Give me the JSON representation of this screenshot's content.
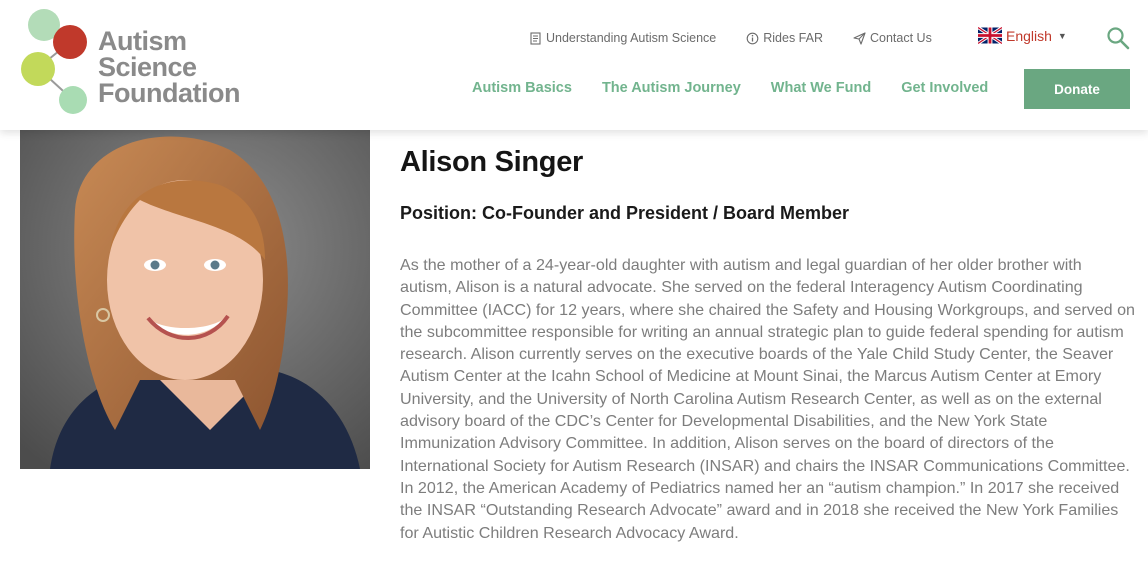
{
  "logo": {
    "line1": "Autism",
    "line2": "Science",
    "line3": "Foundation"
  },
  "util_nav": [
    {
      "label": "Understanding Autism Science",
      "icon": "document-icon"
    },
    {
      "label": "Rides FAR",
      "icon": "info-circle-icon"
    },
    {
      "label": "Contact Us",
      "icon": "paper-plane-icon"
    }
  ],
  "language": {
    "label": "English",
    "flag": "uk-flag-icon"
  },
  "main_nav": [
    {
      "label": "Autism Basics"
    },
    {
      "label": "The Autism Journey"
    },
    {
      "label": "What We Fund"
    },
    {
      "label": "Get Involved"
    }
  ],
  "donate_label": "Donate",
  "profile": {
    "name": "Alison Singer",
    "position": "Position: Co-Founder and President / Board Member",
    "bio": "As the mother of a 24-year-old daughter with autism and legal guardian of her older brother with autism, Alison is a natural advocate. She served on the federal Interagency Autism Coordinating Committee (IACC) for 12 years, where she chaired the Safety and Housing Workgroups, and served on the subcommittee responsible for writing an annual strategic plan to guide federal spending for autism research. Alison currently serves on the executive boards of the Yale Child Study Center, the Seaver Autism Center at the Icahn School of Medicine at Mount Sinai, the Marcus Autism Center at Emory University, and the University of North Carolina Autism Research Center, as well as on the external advisory board of the CDC’s Center for Developmental Disabilities, and the New York State Immunization Advisory Committee. In addition, Alison serves on the board of directors of the International Society for Autism Research (INSAR) and chairs the INSAR Communications Committee. In 2012, the American Academy of Pediatrics named her an “autism champion.” In 2017 she received the INSAR “Outstanding Research Advocate” award and in 2018 she received the New York Families for Autistic Children Research Advocacy Award."
  },
  "colors": {
    "nav_green": "#72b48e",
    "donate_bg": "#6aa781",
    "language_red": "#c0392b",
    "logo_gray": "#8a8a8a",
    "bio_gray": "#7d7d7d"
  }
}
